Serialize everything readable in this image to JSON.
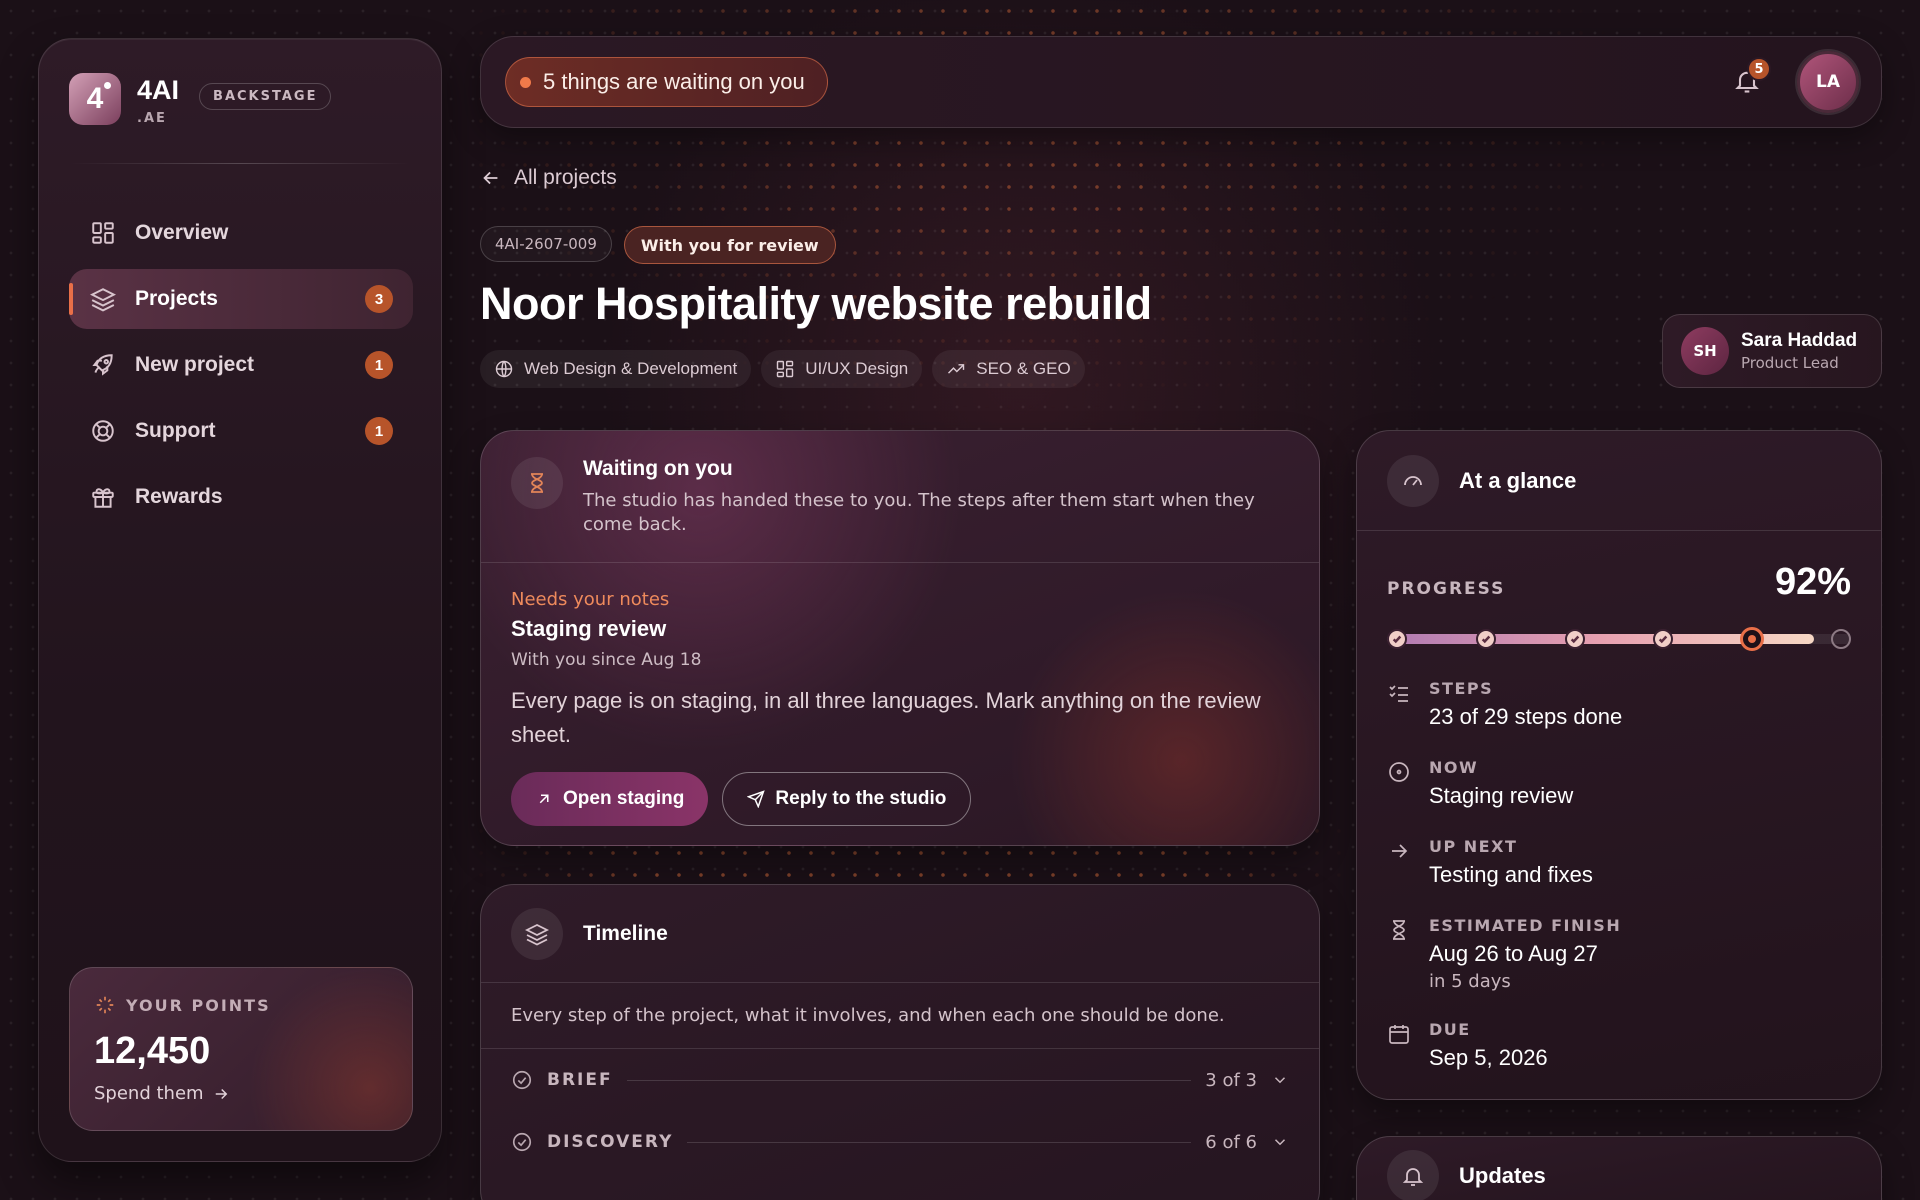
{
  "brand": {
    "name": "4AI",
    "sub": ".AE",
    "logo_glyph": "4",
    "tag": "BACKSTAGE"
  },
  "nav": [
    {
      "label": "Overview",
      "icon": "grid-icon",
      "badge": ""
    },
    {
      "label": "Projects",
      "icon": "layers-icon",
      "badge": "3",
      "active": true
    },
    {
      "label": "New project",
      "icon": "rocket-icon",
      "badge": "1"
    },
    {
      "label": "Support",
      "icon": "lifebuoy-icon",
      "badge": "1"
    },
    {
      "label": "Rewards",
      "icon": "gift-icon",
      "badge": ""
    }
  ],
  "points": {
    "label": "YOUR POINTS",
    "value": "12,450",
    "link": "Spend them"
  },
  "topbar": {
    "waiting": "5 things are waiting on you",
    "notif_count": "5",
    "avatar": "LA"
  },
  "header": {
    "back": "All projects",
    "project_id": "4AI-2607-009",
    "status": "With you for review",
    "title": "Noor Hospitality website rebuild",
    "tags": [
      "Web Design & Development",
      "UI/UX Design",
      "SEO & GEO"
    ]
  },
  "lead": {
    "initials": "SH",
    "name": "Sara Haddad",
    "role": "Product Lead"
  },
  "waiting_card": {
    "title": "Waiting on you",
    "desc": "The studio has handed these to you. The steps after them start when they come back.",
    "tag": "Needs your notes",
    "item_title": "Staging review",
    "since": "With you since Aug 18",
    "item_desc": "Every page is on staging, in all three languages. Mark anything on the review sheet.",
    "primary_btn": "Open staging",
    "secondary_btn": "Reply to the studio"
  },
  "timeline": {
    "title": "Timeline",
    "desc": "Every step of the project, what it involves, and when each one should be done.",
    "phases": [
      {
        "name": "BRIEF",
        "count": "3 of 3"
      },
      {
        "name": "DISCOVERY",
        "count": "6 of 6"
      }
    ]
  },
  "glance": {
    "title": "At a glance",
    "progress_label": "PROGRESS",
    "progress_value": "92%",
    "progress_fraction": 0.92,
    "stops_total": 6,
    "stops_done": 4,
    "stop_current": 5,
    "facts": [
      {
        "label": "STEPS",
        "value": "23 of 29 steps done",
        "sub": "",
        "icon": "checklist-icon"
      },
      {
        "label": "NOW",
        "value": "Staging review",
        "sub": "",
        "icon": "target-icon"
      },
      {
        "label": "UP NEXT",
        "value": "Testing and fixes",
        "sub": "",
        "icon": "arrow-right-icon"
      },
      {
        "label": "ESTIMATED FINISH",
        "value": "Aug 26 to Aug 27",
        "sub": "in 5 days",
        "icon": "hourglass-icon"
      },
      {
        "label": "DUE",
        "value": "Sep 5, 2026",
        "sub": "",
        "icon": "calendar-icon"
      }
    ]
  },
  "updates": {
    "title": "Updates"
  },
  "colors": {
    "accent": "#e96f48",
    "bg": "#1b1017",
    "badge": "#b7542a"
  }
}
